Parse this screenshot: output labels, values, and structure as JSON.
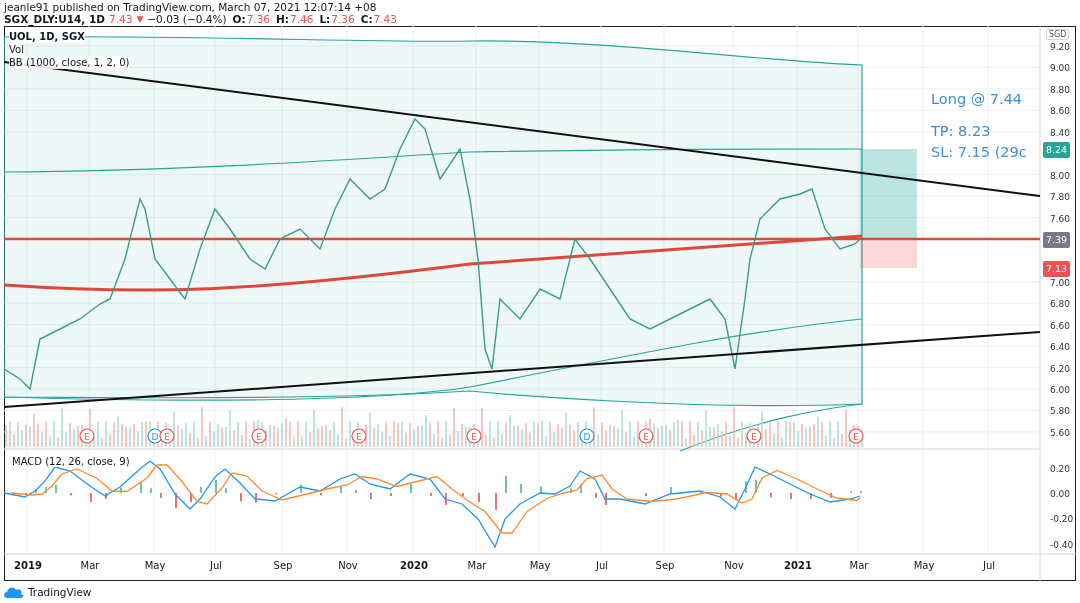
{
  "header": {
    "publisher_line": "jeanle91 published on TradingView.com, March 07, 2021 12:07:14 +08",
    "symbol": "SGX_DLY:U14, 1D",
    "last": "7.43",
    "arrow": "▼",
    "change": "−0.03 (−0.4%)",
    "ohlc": [
      {
        "label": "O:",
        "value": "7.36"
      },
      {
        "label": "H:",
        "value": "7.46"
      },
      {
        "label": "L:",
        "value": "7.36"
      },
      {
        "label": "C:",
        "value": "7.43"
      }
    ]
  },
  "main_pane": {
    "legend": [
      "UOL, 1D, SGX",
      "Vol",
      "BB (1000, close, 1, 2, 0)"
    ],
    "annotation": [
      "Long @ 7.44",
      "TP: 8.23",
      "SL: 7.15 (29c"
    ],
    "currency": "SGD",
    "price_ticks": [
      "9.20",
      "9.00",
      "8.80",
      "8.60",
      "8.40",
      "8.00",
      "7.80",
      "7.60",
      "7.00",
      "6.80",
      "6.60",
      "6.40",
      "6.20",
      "6.00",
      "5.80",
      "5.60"
    ],
    "price_labels": [
      {
        "text": "8.24",
        "color": "#26a69a"
      },
      {
        "text": "7.39",
        "color": "#787b86"
      },
      {
        "text": "7.13",
        "color": "#ef5350"
      }
    ],
    "events": [
      {
        "kind": "earnings",
        "label": "E"
      },
      {
        "kind": "dividend",
        "label": "D"
      },
      {
        "kind": "earnings",
        "label": "E"
      },
      {
        "kind": "earnings",
        "label": "E"
      },
      {
        "kind": "earnings",
        "label": "E"
      },
      {
        "kind": "earnings",
        "label": "E"
      },
      {
        "kind": "dividend",
        "label": "D"
      },
      {
        "kind": "earnings",
        "label": "E"
      },
      {
        "kind": "earnings",
        "label": "E"
      },
      {
        "kind": "earnings",
        "label": "E"
      }
    ]
  },
  "macd_pane": {
    "legend": "MACD (12, 26, close, 9)",
    "ticks": [
      "0.20",
      "0.00",
      "-0.20",
      "-0.40"
    ]
  },
  "time_axis": [
    {
      "label": "2019",
      "bold": true
    },
    {
      "label": "Mar",
      "bold": false
    },
    {
      "label": "May",
      "bold": false
    },
    {
      "label": "Jul",
      "bold": false
    },
    {
      "label": "Sep",
      "bold": false
    },
    {
      "label": "Nov",
      "bold": false
    },
    {
      "label": "2020",
      "bold": true
    },
    {
      "label": "Mar",
      "bold": false
    },
    {
      "label": "May",
      "bold": false
    },
    {
      "label": "Jul",
      "bold": false
    },
    {
      "label": "Sep",
      "bold": false
    },
    {
      "label": "Nov",
      "bold": false
    },
    {
      "label": "2021",
      "bold": true
    },
    {
      "label": "Mar",
      "bold": false
    },
    {
      "label": "May",
      "bold": false
    },
    {
      "label": "Jul",
      "bold": false
    }
  ],
  "footer": {
    "logo": "TradingView"
  }
}
